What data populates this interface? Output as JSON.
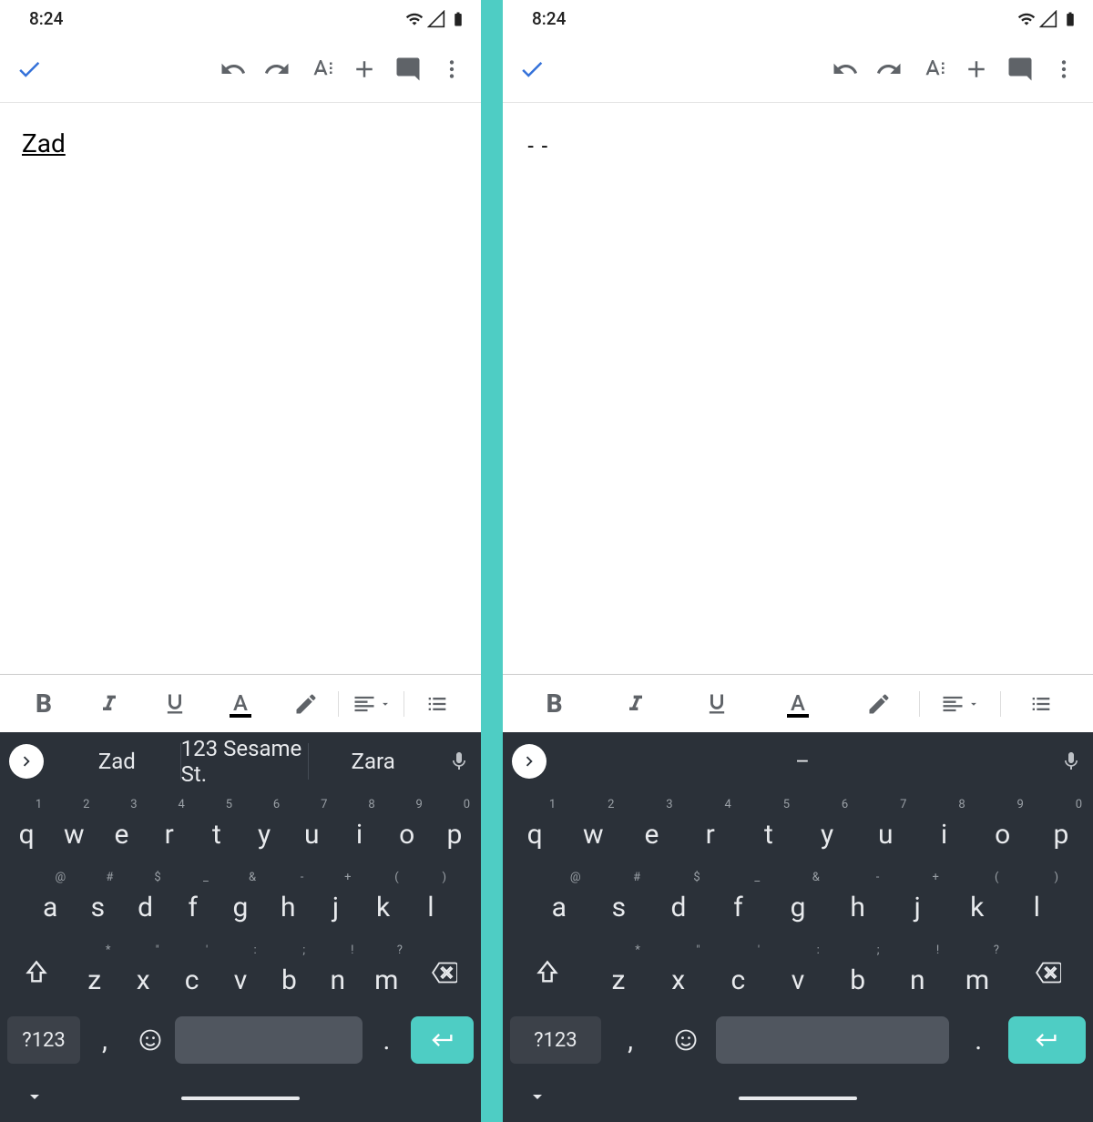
{
  "status": {
    "time": "8:24"
  },
  "toolbar": {
    "check": "✓",
    "undo": "undo",
    "redo": "redo",
    "textformat": "A",
    "insert": "+",
    "comment": "comment",
    "more": "⋮"
  },
  "left": {
    "doc_text": "Zad",
    "suggestions": [
      "Zad",
      "123 Sesame St.",
      "Zara"
    ],
    "center_suggestion": ""
  },
  "right": {
    "doc_text": "--",
    "center_suggestion": "–"
  },
  "fmt": {
    "bold": "B",
    "italic": "I",
    "underline": "U",
    "textcolor": "A",
    "highlight": "✎",
    "align": "align",
    "list": "list"
  },
  "kbd": {
    "row1": [
      {
        "k": "q",
        "s": "1"
      },
      {
        "k": "w",
        "s": "2"
      },
      {
        "k": "e",
        "s": "3"
      },
      {
        "k": "r",
        "s": "4"
      },
      {
        "k": "t",
        "s": "5"
      },
      {
        "k": "y",
        "s": "6"
      },
      {
        "k": "u",
        "s": "7"
      },
      {
        "k": "i",
        "s": "8"
      },
      {
        "k": "o",
        "s": "9"
      },
      {
        "k": "p",
        "s": "0"
      }
    ],
    "row2": [
      {
        "k": "a",
        "s": "@"
      },
      {
        "k": "s",
        "s": "#"
      },
      {
        "k": "d",
        "s": "$"
      },
      {
        "k": "f",
        "s": "_"
      },
      {
        "k": "g",
        "s": "&"
      },
      {
        "k": "h",
        "s": "-"
      },
      {
        "k": "j",
        "s": "+"
      },
      {
        "k": "k",
        "s": "("
      },
      {
        "k": "l",
        "s": ")"
      }
    ],
    "row3": [
      {
        "k": "z",
        "s": "*"
      },
      {
        "k": "x",
        "s": "\""
      },
      {
        "k": "c",
        "s": "'"
      },
      {
        "k": "v",
        "s": ":"
      },
      {
        "k": "b",
        "s": ";"
      },
      {
        "k": "n",
        "s": "!"
      },
      {
        "k": "m",
        "s": "?"
      }
    ],
    "sym": "?123",
    "comma": ",",
    "period": ".",
    "emoji": "☺"
  }
}
